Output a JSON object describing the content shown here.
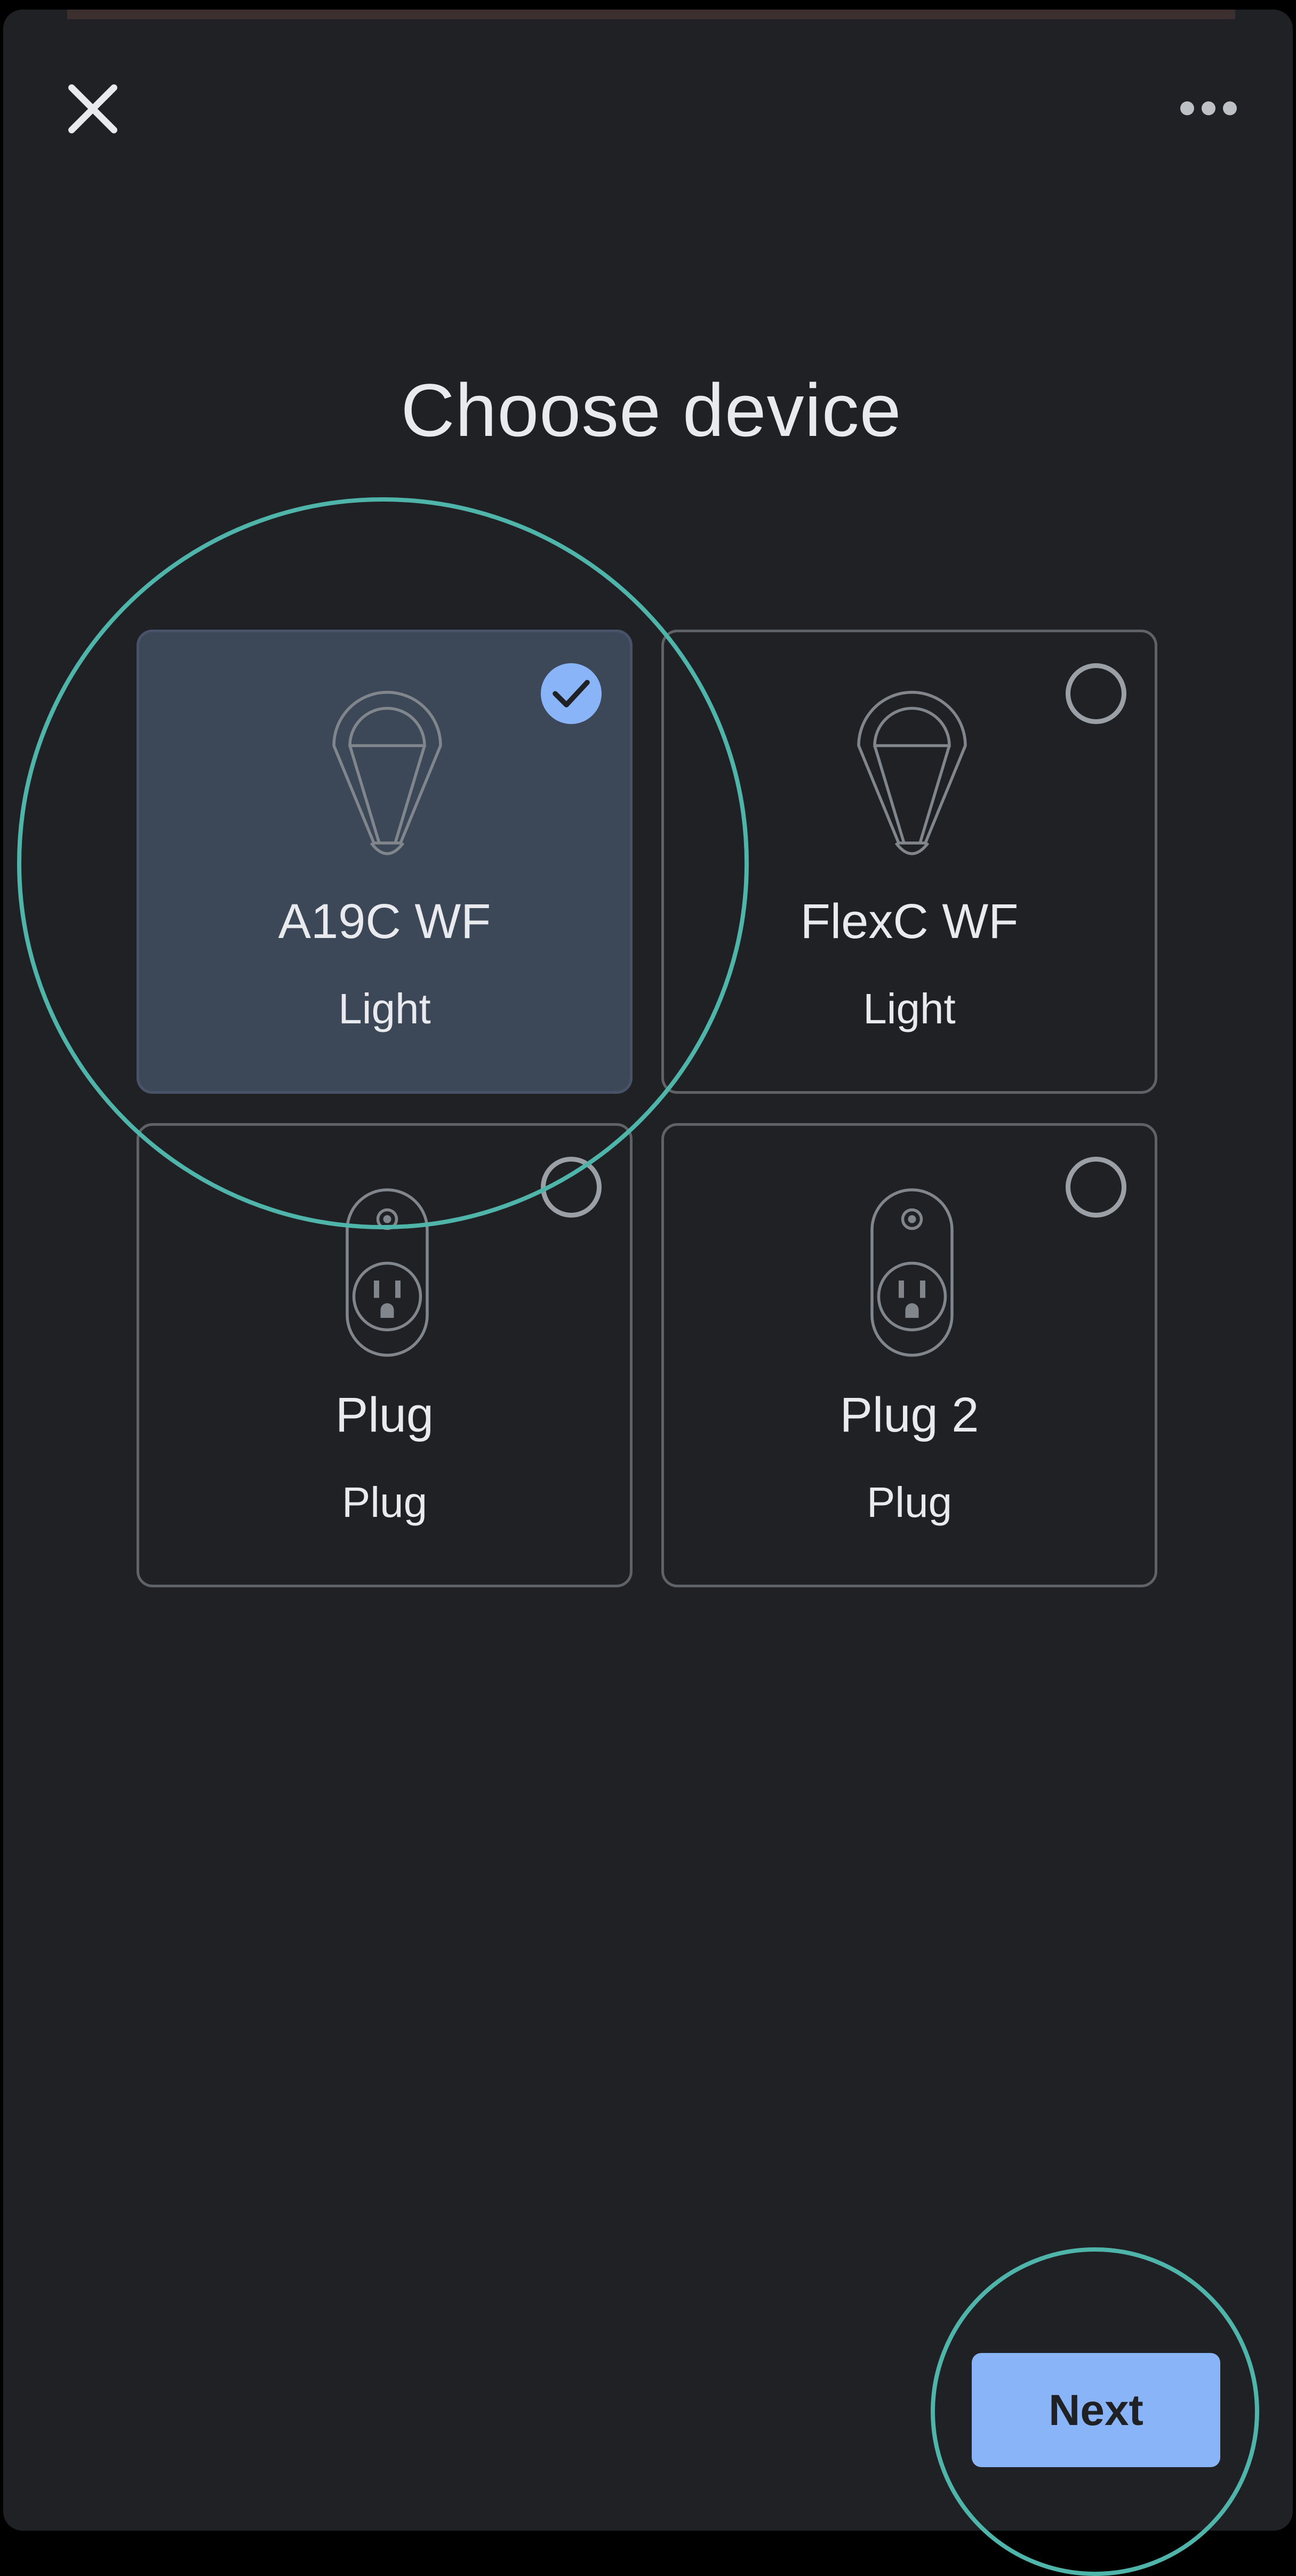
{
  "header": {
    "close_icon": "close-icon",
    "more_icon": "more-horizontal-icon"
  },
  "title": "Choose device",
  "devices": [
    {
      "name": "A19C WF",
      "type": "Light",
      "icon": "bulb-icon",
      "selected": true
    },
    {
      "name": "FlexC WF",
      "type": "Light",
      "icon": "bulb-icon",
      "selected": false
    },
    {
      "name": "Plug",
      "type": "Plug",
      "icon": "outlet-icon",
      "selected": false
    },
    {
      "name": "Plug 2",
      "type": "Plug",
      "icon": "outlet-icon",
      "selected": false
    }
  ],
  "footer": {
    "next_label": "Next"
  },
  "colors": {
    "background": "#202124",
    "selected_card": "#3c4758",
    "accent": "#8ab4f8",
    "highlight_ring": "#4fb5aa",
    "card_border": "#5f6368"
  }
}
